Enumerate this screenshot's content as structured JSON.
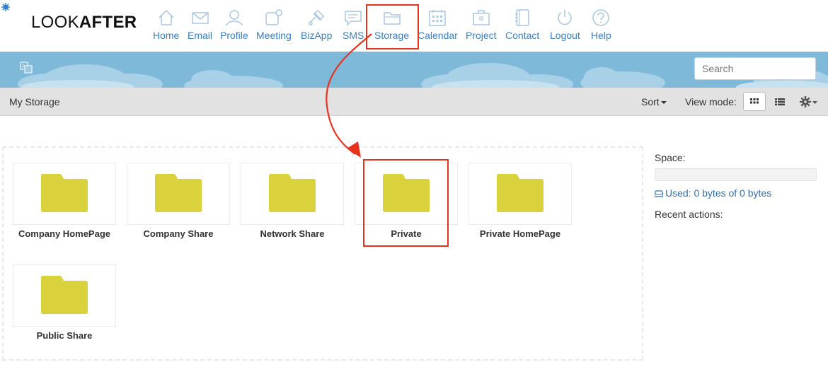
{
  "brand": {
    "logo_light": "LOOK",
    "logo_bold": "AFTER"
  },
  "nav": [
    {
      "label": "Home",
      "icon": "home-icon"
    },
    {
      "label": "Email",
      "icon": "email-icon"
    },
    {
      "label": "Profile",
      "icon": "profile-icon"
    },
    {
      "label": "Meeting",
      "icon": "meeting-icon"
    },
    {
      "label": "BizApp",
      "icon": "bizapp-icon"
    },
    {
      "label": "SMS",
      "icon": "sms-icon"
    },
    {
      "label": "Storage",
      "icon": "folder-icon"
    },
    {
      "label": "Calendar",
      "icon": "calendar-icon"
    },
    {
      "label": "Project",
      "icon": "briefcase-icon"
    },
    {
      "label": "Contact",
      "icon": "contact-book-icon"
    },
    {
      "label": "Logout",
      "icon": "power-icon"
    },
    {
      "label": "Help",
      "icon": "help-icon"
    }
  ],
  "search": {
    "placeholder": "Search"
  },
  "toolbar": {
    "breadcrumb": "My Storage",
    "sort_label": "Sort",
    "view_mode_label": "View mode:",
    "active_view": "grid"
  },
  "folders": [
    {
      "name": "Company HomePage"
    },
    {
      "name": "Company Share"
    },
    {
      "name": "Network Share"
    },
    {
      "name": "Private"
    },
    {
      "name": "Private HomePage"
    },
    {
      "name": "Public Share"
    }
  ],
  "side": {
    "space_label": "Space:",
    "used_text": "Used: 0 bytes of 0 bytes",
    "used_fraction": 0,
    "recent_label": "Recent actions:"
  },
  "colors": {
    "accent": "#3a7fc1",
    "folder": "#d9d23c",
    "sky": "#7fb9d9",
    "annotation": "#e8321e"
  }
}
